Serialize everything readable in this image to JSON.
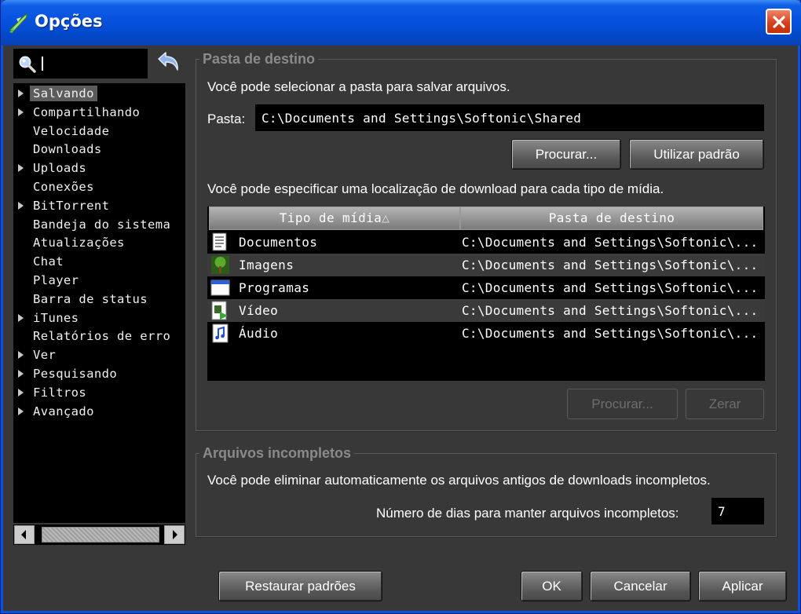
{
  "window": {
    "title": "Opções",
    "accent": "#0651de",
    "close_color": "#d8401c"
  },
  "search": {
    "value": ""
  },
  "sidebar": {
    "items": [
      {
        "label": "Salvando",
        "arrow": true,
        "selected": true
      },
      {
        "label": "Compartilhando",
        "arrow": true
      },
      {
        "label": "Velocidade",
        "arrow": false
      },
      {
        "label": "Downloads",
        "arrow": false
      },
      {
        "label": "Uploads",
        "arrow": true
      },
      {
        "label": "Conexões",
        "arrow": false
      },
      {
        "label": "BitTorrent",
        "arrow": true
      },
      {
        "label": "Bandeja do sistema",
        "arrow": false
      },
      {
        "label": "Atualizações",
        "arrow": false
      },
      {
        "label": "Chat",
        "arrow": false
      },
      {
        "label": "Player",
        "arrow": false
      },
      {
        "label": "Barra de status",
        "arrow": false
      },
      {
        "label": "iTunes",
        "arrow": true
      },
      {
        "label": "Relatórios de erro",
        "arrow": false
      },
      {
        "label": "Ver",
        "arrow": true
      },
      {
        "label": "Pesquisando",
        "arrow": true
      },
      {
        "label": "Filtros",
        "arrow": true
      },
      {
        "label": "Avançado",
        "arrow": true
      }
    ]
  },
  "destination": {
    "title": "Pasta de destino",
    "description": "Você pode selecionar a pasta para salvar arquivos.",
    "folder_label": "Pasta:",
    "folder_value": "C:\\Documents and Settings\\Softonic\\Shared",
    "browse_label": "Procurar...",
    "use_default_label": "Utilizar padrão",
    "media_description": "Você pode especificar uma localização de download para cada tipo de mídia.",
    "columns": [
      "Tipo de mídia",
      "Pasta de destino"
    ],
    "sort_indicator": "△",
    "rows": [
      {
        "icon": "document-icon",
        "type": "Documentos",
        "path": "C:\\Documents and Settings\\Softonic\\..."
      },
      {
        "icon": "image-icon",
        "type": "Imagens",
        "path": "C:\\Documents and Settings\\Softonic\\..."
      },
      {
        "icon": "program-icon",
        "type": "Programas",
        "path": "C:\\Documents and Settings\\Softonic\\..."
      },
      {
        "icon": "video-icon",
        "type": "Vídeo",
        "path": "C:\\Documents and Settings\\Softonic\\..."
      },
      {
        "icon": "audio-icon",
        "type": "Áudio",
        "path": "C:\\Documents and Settings\\Softonic\\..."
      }
    ],
    "table_browse_label": "Procurar...",
    "reset_label": "Zerar"
  },
  "incomplete": {
    "title": "Arquivos incompletos",
    "description": "Você pode eliminar automaticamente os arquivos antigos de downloads incompletos.",
    "days_label": "Número de dias para manter arquivos incompletos:",
    "days_value": "7"
  },
  "footer": {
    "restore_label": "Restaurar padrões",
    "ok_label": "OK",
    "cancel_label": "Cancelar",
    "apply_label": "Aplicar"
  }
}
